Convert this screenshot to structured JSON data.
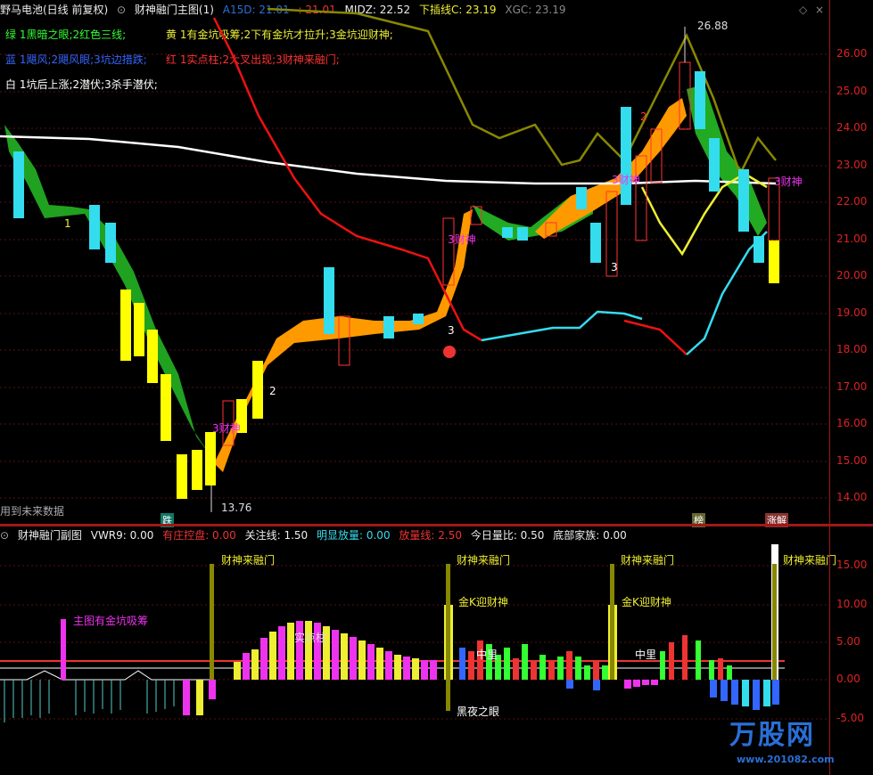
{
  "header": {
    "title": "野马电池(日线 前复权)",
    "indicator_name": "财神融门主图(1)",
    "a15d": "A15D: 21.01",
    "val2": ": 21.01",
    "midz": "MIDZ: 22.52",
    "xiachaxian": "下插线C: 23.19",
    "xgc": "XGC: 23.19"
  },
  "legend": {
    "green": "绿 1黑暗之眼;2红色三线;",
    "yellow": "黄 1有金坑吸筹;2下有金坑才拉升;3金坑迎财神;",
    "blue": "蓝 1飓风;2飓风眼;3坑边措跌;",
    "red": "红 1实点柱;2大叉出现;3财神来融门;",
    "white": "白 1坑后上涨;2潜伏;3杀手潜伏;"
  },
  "main_labels": {
    "high_price": "26.88",
    "low_price": "13.76",
    "future_data": "用到未来数据",
    "cai_shen": "财神",
    "num1": "1",
    "num2": "2",
    "num3": "3",
    "tag_die": "跌",
    "tag_bang": "榜",
    "tag_zhangjie": "涨解"
  },
  "price_axis": [
    "26.00",
    "25.00",
    "24.00",
    "23.00",
    "22.00",
    "21.00",
    "20.00",
    "19.00",
    "18.00",
    "17.00",
    "16.00",
    "15.00",
    "14.00"
  ],
  "sub_header": {
    "name": "财神融门副图",
    "vwr9": "VWR9: 0.00",
    "zhuang": "有庄控盘: 0.00",
    "guanzhu": "关注线: 1.50",
    "mingxian": "明显放量: 0.00",
    "fangliang": "放量线: 2.50",
    "jinri": "今日量比: 0.50",
    "dibu": "底部家族: 0.00"
  },
  "sub_labels": {
    "cai_shen_lai": "财神来融门",
    "jin_k": "金K迎财神",
    "zhu_tu": "主图有金坑吸筹",
    "zhong_li": "中里",
    "hei_ye": "黑夜之眼",
    "shi_dian": "实点柱"
  },
  "sub_axis": [
    "15.00",
    "10.00",
    "5.00",
    "0.00",
    "-5.00"
  ],
  "watermark": {
    "text": "万股网",
    "url": "www.201082.com"
  },
  "colors": {
    "up": "#ff3030",
    "down": "#30e0ff",
    "accent": "#d22",
    "bg": "#000000"
  }
}
